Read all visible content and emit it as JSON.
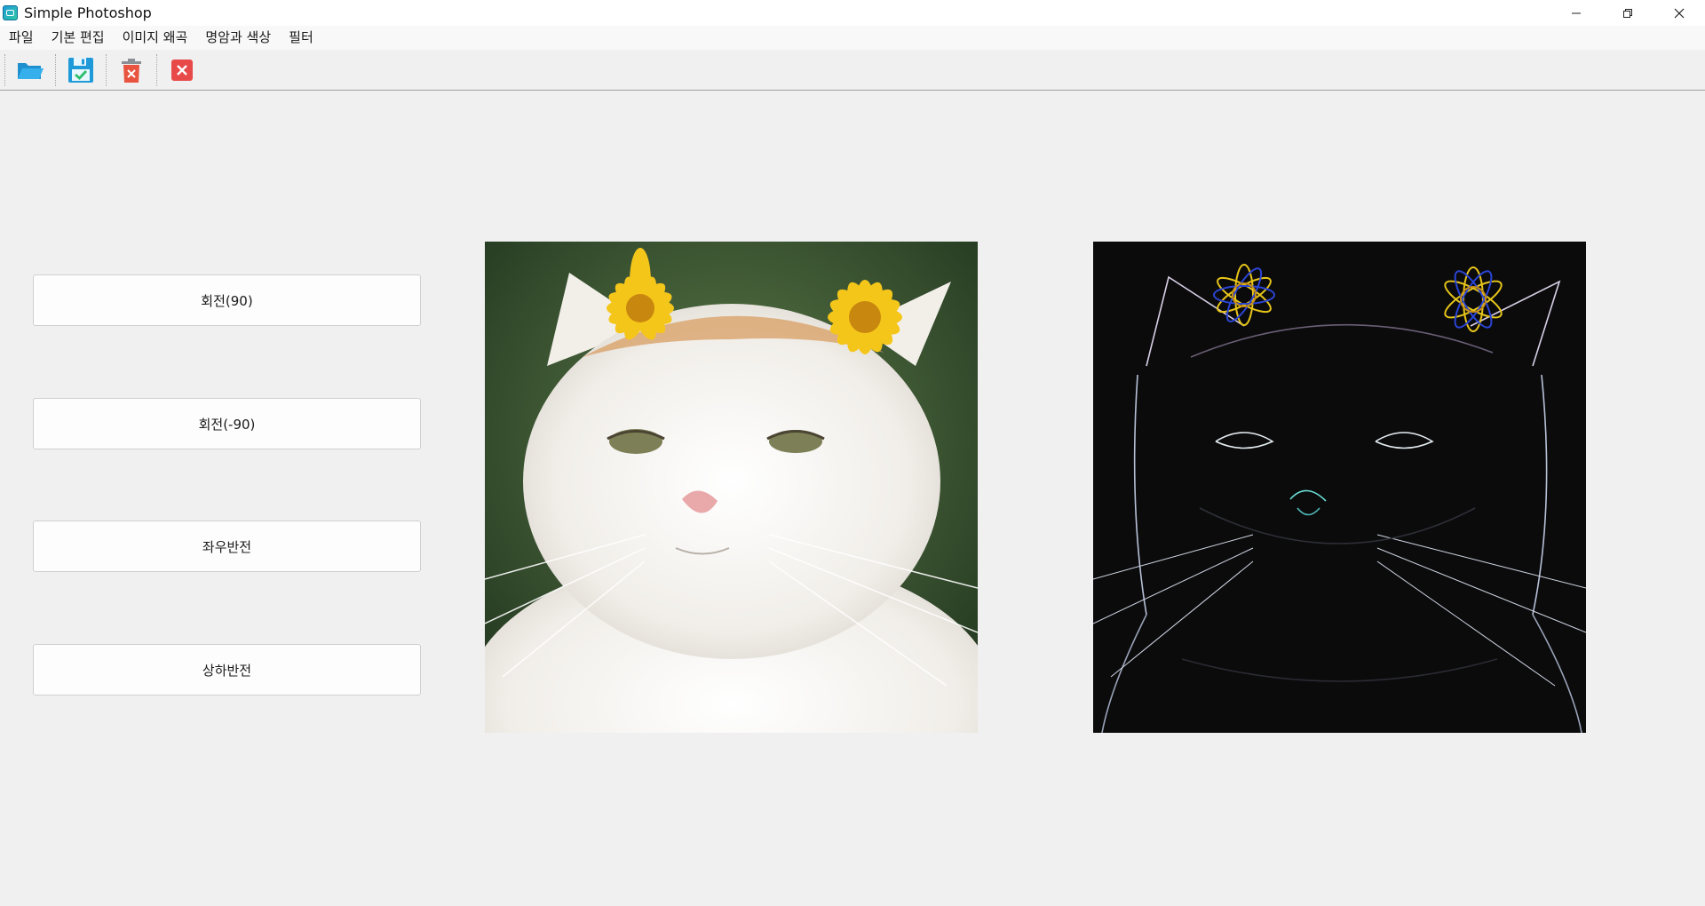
{
  "window": {
    "title": "Simple Photoshop",
    "icon": "app-icon"
  },
  "menu": {
    "items": [
      {
        "label": "파일"
      },
      {
        "label": "기본 편집"
      },
      {
        "label": "이미지 왜곡"
      },
      {
        "label": "명암과 색상"
      },
      {
        "label": "필터"
      }
    ]
  },
  "toolbar": {
    "buttons": [
      {
        "icon": "open-folder-icon",
        "color": "#2aa3e0"
      },
      {
        "icon": "save-icon",
        "color": "#1e9ad8"
      },
      {
        "icon": "delete-icon",
        "color": "#e8543f"
      },
      {
        "icon": "close-icon",
        "color": "#e84a4a"
      }
    ]
  },
  "operations": {
    "rotate_cw": "회전(90)",
    "rotate_ccw": "회전(-90)",
    "flip_horizontal": "좌우반전",
    "flip_vertical": "상하반전"
  },
  "images": {
    "original": "original cat photo with yellow flowers",
    "filtered": "edge-detection filtered cat image"
  },
  "colors": {
    "window_bg": "#f0f0f0",
    "button_bg": "#fdfdfd",
    "button_border": "#cfcfcf",
    "flower_yellow": "#f5c61a",
    "edge_dark": "#0b0b0c"
  }
}
